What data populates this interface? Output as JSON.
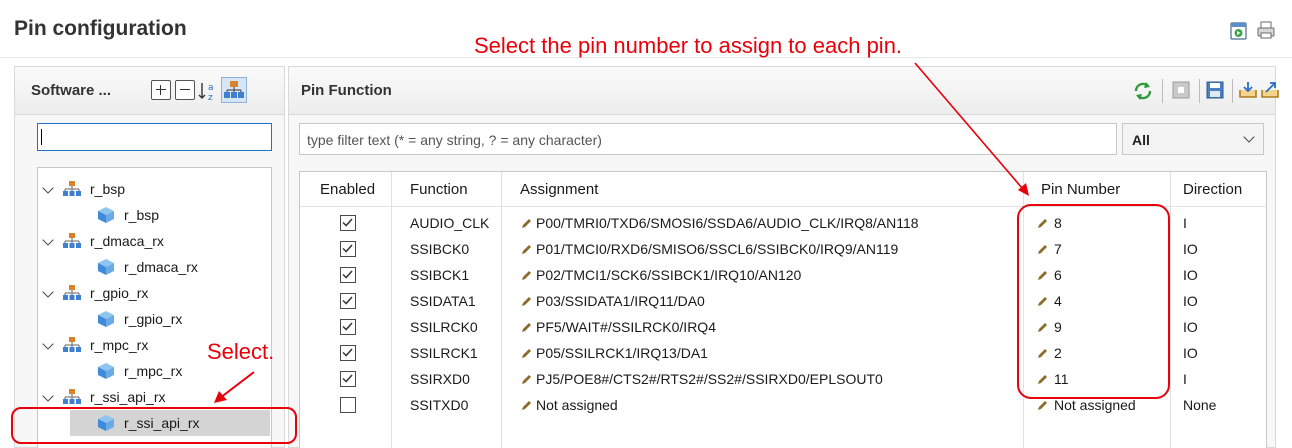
{
  "title": "Pin configuration",
  "annotations": {
    "top": "Select the pin number to assign to each pin.",
    "select": "Select."
  },
  "left_panel": {
    "header": "Software ...",
    "filter_value": "",
    "tree": [
      {
        "label": "r_bsp",
        "kind": "component"
      },
      {
        "label": "r_bsp",
        "kind": "module"
      },
      {
        "label": "r_dmaca_rx",
        "kind": "component"
      },
      {
        "label": "r_dmaca_rx",
        "kind": "module"
      },
      {
        "label": "r_gpio_rx",
        "kind": "component"
      },
      {
        "label": "r_gpio_rx",
        "kind": "module"
      },
      {
        "label": "r_mpc_rx",
        "kind": "component"
      },
      {
        "label": "r_mpc_rx",
        "kind": "module"
      },
      {
        "label": "r_ssi_api_rx",
        "kind": "component"
      },
      {
        "label": "r_ssi_api_rx",
        "kind": "module",
        "selected": true
      }
    ]
  },
  "right_panel": {
    "header": "Pin Function",
    "filter_placeholder": "type filter text (* = any string, ? = any character)",
    "filter_combo": "All",
    "columns": [
      "Enabled",
      "Function",
      "Assignment",
      "Pin Number",
      "Direction"
    ],
    "rows": [
      {
        "enabled": true,
        "function": "AUDIO_CLK",
        "assignment": "P00/TMRI0/TXD6/SMOSI6/SSDA6/AUDIO_CLK/IRQ8/AN118",
        "pin": "8",
        "direction": "I"
      },
      {
        "enabled": true,
        "function": "SSIBCK0",
        "assignment": "P01/TMCI0/RXD6/SMISO6/SSCL6/SSIBCK0/IRQ9/AN119",
        "pin": "7",
        "direction": "IO"
      },
      {
        "enabled": true,
        "function": "SSIBCK1",
        "assignment": "P02/TMCI1/SCK6/SSIBCK1/IRQ10/AN120",
        "pin": "6",
        "direction": "IO"
      },
      {
        "enabled": true,
        "function": "SSIDATA1",
        "assignment": "P03/SSIDATA1/IRQ11/DA0",
        "pin": "4",
        "direction": "IO"
      },
      {
        "enabled": true,
        "function": "SSILRCK0",
        "assignment": "PF5/WAIT#/SSILRCK0/IRQ4",
        "pin": "9",
        "direction": "IO"
      },
      {
        "enabled": true,
        "function": "SSILRCK1",
        "assignment": "P05/SSILRCK1/IRQ13/DA1",
        "pin": "2",
        "direction": "IO"
      },
      {
        "enabled": true,
        "function": "SSIRXD0",
        "assignment": "PJ5/POE8#/CTS2#/RTS2#/SS2#/SSIRXD0/EPLSOUT0",
        "pin": "11",
        "direction": "I"
      },
      {
        "enabled": false,
        "function": "SSITXD0",
        "assignment": "Not assigned",
        "pin": "Not assigned",
        "direction": "None"
      }
    ]
  },
  "colors": {
    "annotation": "#e8000a",
    "accent": "#1a73c7"
  }
}
